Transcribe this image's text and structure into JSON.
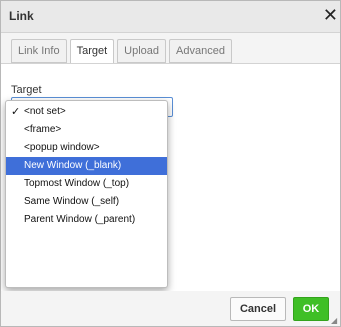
{
  "dialog": {
    "title": "Link",
    "close_glyph": "✕"
  },
  "tabs": [
    {
      "label": "Link Info",
      "active": false
    },
    {
      "label": "Target",
      "active": true
    },
    {
      "label": "Upload",
      "active": false
    },
    {
      "label": "Advanced",
      "active": false
    }
  ],
  "target": {
    "label": "Target",
    "options": [
      {
        "label": "<not set>",
        "checked": true
      },
      {
        "label": "<frame>"
      },
      {
        "label": "<popup window>"
      },
      {
        "label": "New Window (_blank)",
        "highlighted": true
      },
      {
        "label": "Topmost Window (_top)"
      },
      {
        "label": "Same Window (_self)"
      },
      {
        "label": "Parent Window (_parent)"
      }
    ]
  },
  "footer": {
    "cancel_label": "Cancel",
    "ok_label": "OK"
  },
  "colors": {
    "accent": "#3fbf26",
    "highlight": "#3f6fd9"
  }
}
